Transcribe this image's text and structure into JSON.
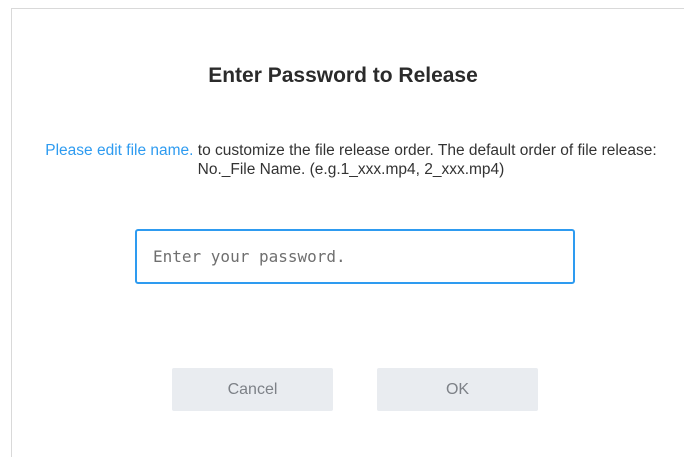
{
  "dialog": {
    "title": "Enter Password to Release",
    "description_link": "Please edit file name.",
    "description_text": " to customize the file release order. The default order of file release: No._File Name. (e.g.1_xxx.mp4, 2_xxx.mp4)",
    "password_placeholder": "Enter your password.",
    "password_value": "",
    "cancel_label": "Cancel",
    "ok_label": "OK"
  },
  "colors": {
    "accent": "#2e9bf0",
    "button_bg": "#e9ecf0",
    "button_text": "#7d8187",
    "title_text": "#2b2b2b"
  }
}
